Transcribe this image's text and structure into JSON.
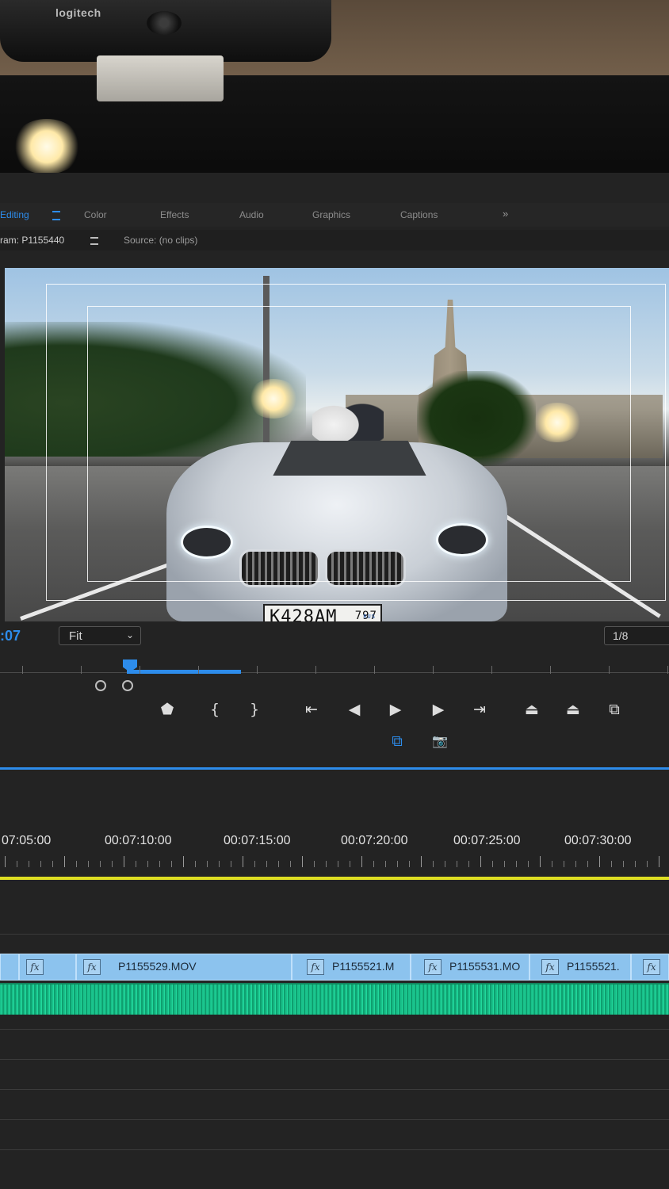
{
  "webcam": {
    "brand": "logitech"
  },
  "workspaces": {
    "tabs": [
      {
        "label": "Editing",
        "active": true
      },
      {
        "label": "Color",
        "active": false
      },
      {
        "label": "Effects",
        "active": false
      },
      {
        "label": "Audio",
        "active": false
      },
      {
        "label": "Graphics",
        "active": false
      },
      {
        "label": "Captions",
        "active": false
      }
    ],
    "more_glyph": "»"
  },
  "panels": {
    "program_tab": "ram: P1155440",
    "source_tab": "Source: (no clips)"
  },
  "video": {
    "plate_number": "К428АМ",
    "plate_region": "797",
    "plate_country": "RUS"
  },
  "program_monitor": {
    "timecode": ":07",
    "fit_value": "Fit",
    "resolution_value": "1/8"
  },
  "controls": {
    "add_marker_glyph": "⬟",
    "mark_in_glyph": "{",
    "mark_out_glyph": "}",
    "go_to_in_glyph": "⇤",
    "step_back_glyph": "◀",
    "play_glyph": "▶",
    "step_forward_glyph": "▶",
    "go_to_out_glyph": "⇥",
    "lift_glyph": "⏏",
    "extract_glyph": "⏏",
    "export_frame_glyph": "📷",
    "comparison_glyph": "⧉"
  },
  "timeline": {
    "ruler_labels": [
      "07:05:00",
      "00:07:10:00",
      "00:07:15:00",
      "00:07:20:00",
      "00:07:25:00",
      "00:07:30:00"
    ],
    "clips": [
      {
        "name": "",
        "fx": "fx"
      },
      {
        "name": "P1155529.MOV",
        "fx": "fx"
      },
      {
        "name": "P1155521.M",
        "fx": "fx"
      },
      {
        "name": "P1155531.MO",
        "fx": "fx"
      },
      {
        "name": "P1155521.",
        "fx": "fx"
      },
      {
        "name": "",
        "fx": "fx"
      }
    ]
  },
  "colors": {
    "accent": "#2d8ceb",
    "clip_video": "#8cc3ee",
    "clip_audio": "#19c08a",
    "work_area": "#dede22"
  }
}
